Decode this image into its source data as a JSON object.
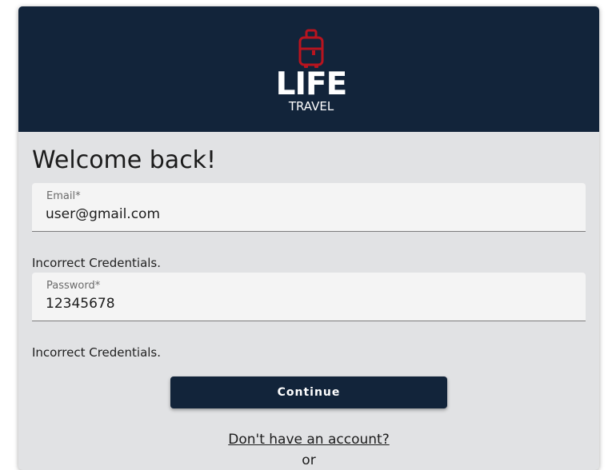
{
  "brand": {
    "word": "LIFE",
    "sub": "TRAVEL",
    "accent_color": "#b8141f",
    "header_color": "#12243a"
  },
  "form": {
    "title": "Welcome back!",
    "email": {
      "label": "Email*",
      "value": "user@gmail.com",
      "error": "Incorrect Credentials."
    },
    "password": {
      "label": "Password*",
      "value": "12345678",
      "error": "Incorrect Credentials."
    },
    "continue_label": "Continue",
    "signup_link": "Don't have an account?",
    "or_text": "or"
  }
}
